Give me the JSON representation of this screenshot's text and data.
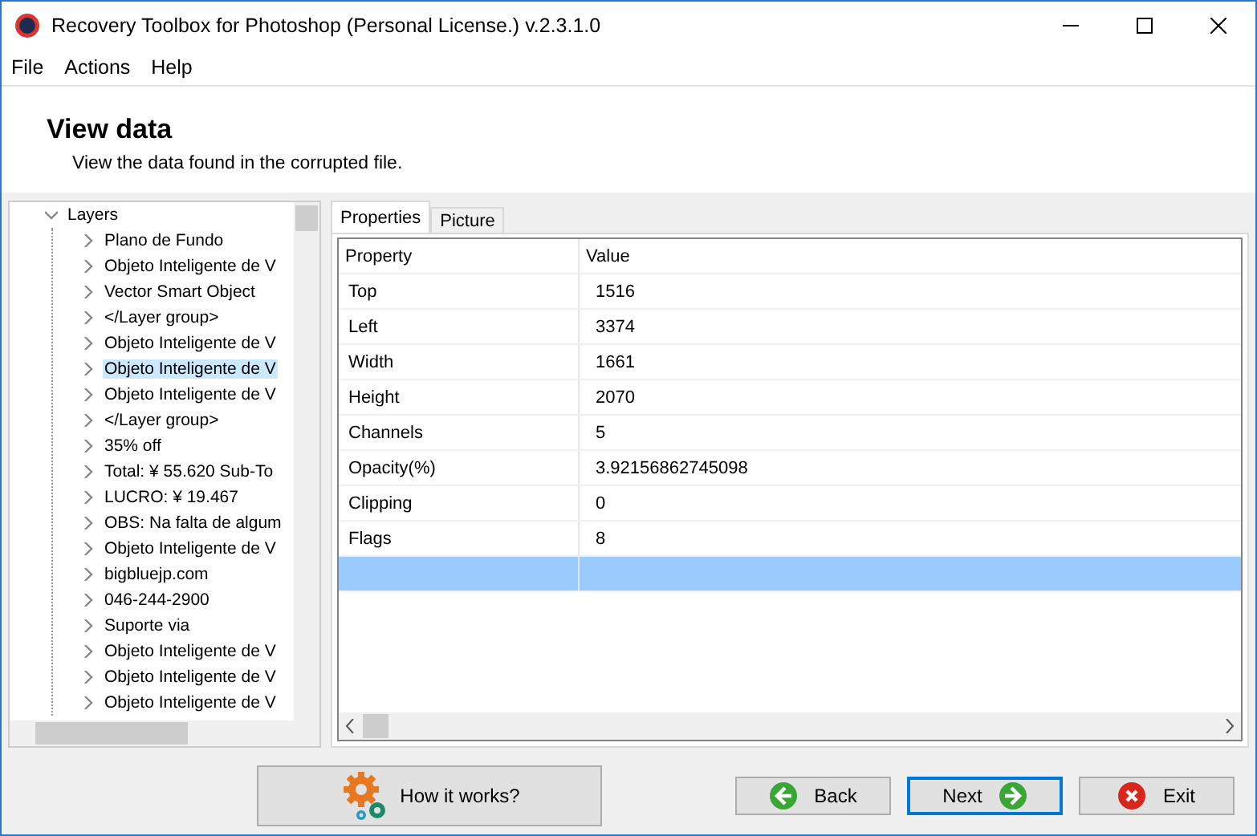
{
  "window": {
    "title": "Recovery Toolbox for Photoshop (Personal License.) v.2.3.1.0"
  },
  "menu": [
    "File",
    "Actions",
    "Help"
  ],
  "header": {
    "title": "View data",
    "subtitle": "View the data found in the corrupted file."
  },
  "tree": {
    "label": "Layers",
    "expanded": true,
    "children": [
      {
        "label": "Plano de Fundo",
        "selected": false
      },
      {
        "label": "Objeto Inteligente de V",
        "selected": false
      },
      {
        "label": "Vector Smart Object",
        "selected": false
      },
      {
        "label": "</Layer group>",
        "selected": false
      },
      {
        "label": "Objeto Inteligente de V",
        "selected": false
      },
      {
        "label": "Objeto Inteligente de V",
        "selected": true
      },
      {
        "label": "Objeto Inteligente de V",
        "selected": false
      },
      {
        "label": "</Layer group>",
        "selected": false
      },
      {
        "label": "35% off",
        "selected": false
      },
      {
        "label": "Total: ¥ 55.620 Sub-To",
        "selected": false
      },
      {
        "label": "LUCRO: ¥ 19.467",
        "selected": false
      },
      {
        "label": "OBS: Na falta de algum",
        "selected": false
      },
      {
        "label": "Objeto Inteligente de V",
        "selected": false
      },
      {
        "label": "bigbluejp.com",
        "selected": false
      },
      {
        "label": "046-244-2900",
        "selected": false
      },
      {
        "label": "Suporte via",
        "selected": false
      },
      {
        "label": "Objeto Inteligente de V",
        "selected": false
      },
      {
        "label": "Objeto Inteligente de V",
        "selected": false
      },
      {
        "label": "Objeto Inteligente de V",
        "selected": false
      }
    ]
  },
  "tabs": [
    {
      "label": "Properties",
      "selected": true
    },
    {
      "label": "Picture",
      "selected": false
    }
  ],
  "table": {
    "columns": [
      "Property",
      "Value"
    ],
    "rows": [
      {
        "cells": [
          "Top",
          "1516"
        ],
        "selected": false
      },
      {
        "cells": [
          "Left",
          "3374"
        ],
        "selected": false
      },
      {
        "cells": [
          "Width",
          "1661"
        ],
        "selected": false
      },
      {
        "cells": [
          "Height",
          "2070"
        ],
        "selected": false
      },
      {
        "cells": [
          "Channels",
          "5"
        ],
        "selected": false
      },
      {
        "cells": [
          "Opacity(%)",
          "3.92156862745098"
        ],
        "selected": false
      },
      {
        "cells": [
          "Clipping",
          "0"
        ],
        "selected": false
      },
      {
        "cells": [
          "Flags",
          "8"
        ],
        "selected": false
      },
      {
        "cells": [],
        "selected": true
      }
    ]
  },
  "buttons": [
    {
      "kind": "help",
      "label": "How it works?"
    },
    {
      "kind": "back",
      "label": "Back"
    },
    {
      "kind": "next",
      "label": "Next",
      "default": true
    },
    {
      "kind": "exit",
      "label": "Exit"
    }
  ]
}
